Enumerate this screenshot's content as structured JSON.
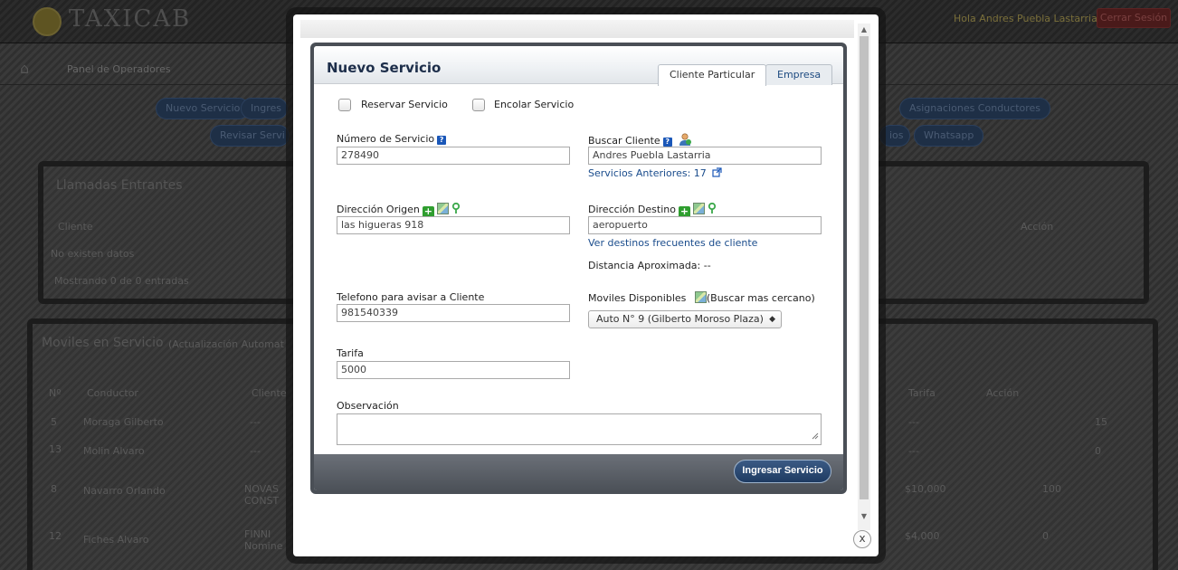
{
  "background": {
    "logo_text": "TAXICAB",
    "user_greeting": "Hola Andres Puebla Lastarria",
    "logout_label": "Cerrar Sesión",
    "breadcrumb": "Panel de Operadores",
    "nav_row1": [
      "Nuevo Servicio",
      "Ingres",
      "Asignaciones Conductores"
    ],
    "nav_row2": [
      "Revisar Servi",
      "ios",
      "Whatsapp"
    ],
    "panel1": {
      "title": "Llamadas Entrantes",
      "col_client": "Cliente",
      "col_action": "Acción",
      "empty": "No existen datos",
      "footer": "Mostrando 0 de 0 entradas"
    },
    "panel2": {
      "title": "Moviles en Servicio",
      "subtitle": "(Actualización Automat",
      "col_num": "Nº",
      "col_driver": "Conductor",
      "col_client": "Cliente",
      "col_fare": "Tarifa",
      "col_action": "Acción",
      "rows": [
        {
          "num": "5",
          "driver": "Moraga Gilberto",
          "client": "---",
          "fare": "---",
          "extra": "15"
        },
        {
          "num": "13",
          "driver": "Molin Alvaro",
          "client": "---",
          "fare": "---",
          "extra": "0"
        },
        {
          "num": "8",
          "driver": "Navarro Orlando",
          "client": "NOVAS CONST",
          "fare": "$10,000",
          "extra": "100"
        },
        {
          "num": "12",
          "driver": "Fiches Alvaro",
          "client": "FINNI Nomine",
          "fare": "$4,000",
          "extra": "0"
        }
      ]
    }
  },
  "form": {
    "title": "Nuevo Servicio",
    "tabs": [
      {
        "label": "Cliente Particular",
        "active": true
      },
      {
        "label": "Empresa",
        "active": false
      }
    ],
    "reserve_label": "Reservar Servicio",
    "queue_label": "Encolar Servicio",
    "service_number_label": "Número de Servicio",
    "service_number_value": "278490",
    "search_client_label": "Buscar Cliente",
    "search_client_value": "Andres Puebla Lastarria",
    "previous_services": "Servicios Anteriores: 17",
    "origin_label": "Dirección Origen",
    "origin_value": "las higueras 918",
    "destination_label": "Dirección Destino",
    "destination_value": "aeropuerto",
    "frequent_destinations_link": "Ver destinos frecuentes de cliente",
    "distance_text": "Distancia Aproximada: --",
    "phone_label": "Telefono para avisar a Cliente",
    "phone_value": "981540339",
    "mobiles_label": "Moviles Disponibles",
    "nearest_label": "(Buscar mas cercano)",
    "mobile_selected": "Auto N° 9 (Gilberto Moroso Plaza)",
    "fare_label": "Tarifa",
    "fare_value": "5000",
    "notes_label": "Observación",
    "submit_label": "Ingresar Servicio",
    "close_symbol": "x"
  },
  "colors": {
    "title": "#1d2e4a",
    "link": "#1a4c8c",
    "submit": "#1e3b62",
    "panel_frame": "#4a4f56"
  }
}
